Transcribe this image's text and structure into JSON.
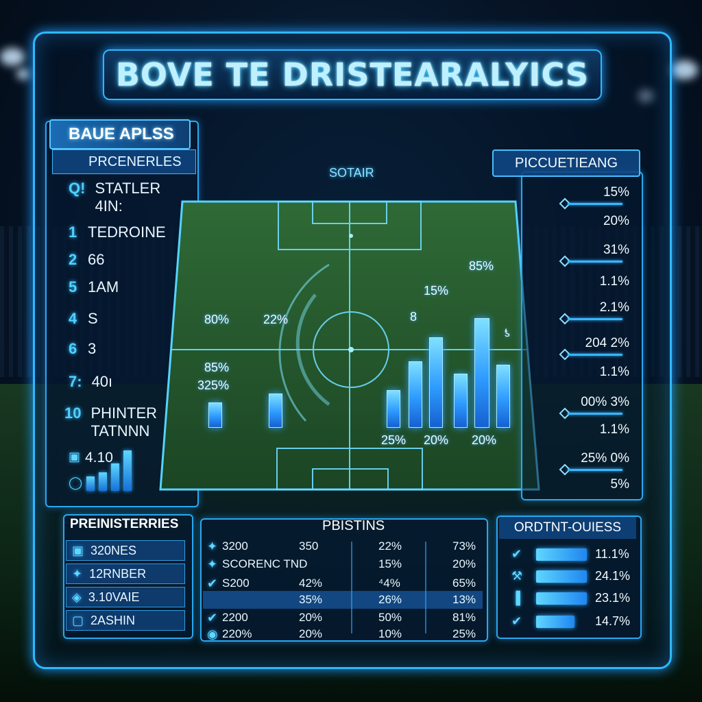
{
  "title": "BOVE TE DRISTEARALYICS",
  "left_panel": {
    "tag": "BAUE APLSS",
    "subheader": "PRCENERLES",
    "rows": [
      {
        "num": "Q!",
        "label": "STATLER",
        "label2": "4IN:"
      },
      {
        "num": "1",
        "label": "TEDROINE"
      },
      {
        "num": "2",
        "label": "66"
      },
      {
        "num": "5",
        "label": "1AM"
      },
      {
        "num": "4",
        "label": "S"
      },
      {
        "num": "6",
        "label": "3"
      },
      {
        "num": "7:",
        "label": "40ı"
      },
      {
        "num": "10",
        "label": "PHINTER",
        "label2": "TATNNN"
      }
    ],
    "mini_value": "4.10",
    "mini_bars": [
      0.28,
      0.36,
      0.52,
      0.78
    ]
  },
  "pitch": {
    "label": "SOTAIR",
    "labels": {
      "l1": "80%",
      "l2": "85%",
      "l3": "325%",
      "l4": "22%",
      "b1": "8",
      "b2": "15%",
      "b3": "85%",
      "b4": "25%",
      "b5": "20%",
      "b6": "20%",
      "b7": "ƾ"
    },
    "bars": [
      0.16,
      0.22,
      0.24,
      0.43,
      0.59,
      0.35,
      0.72,
      0.41
    ]
  },
  "right_panel": {
    "tag": "PICCUETIEANG",
    "values": [
      "15%",
      "20%",
      "31%",
      "1.1%",
      "2.1%",
      "204 2%",
      "1.1%",
      "00% 3%",
      "1.1%",
      "25% 0%",
      "5%"
    ]
  },
  "bottom_left": {
    "title": "PREINISTERRIES",
    "items": [
      {
        "icon": "shield-icon",
        "label": "320NES"
      },
      {
        "icon": "runner-icon",
        "label": "12RNBER"
      },
      {
        "icon": "badge-icon",
        "label": "3.10VAIE"
      },
      {
        "icon": "box-icon",
        "label": "2ASHIN"
      }
    ]
  },
  "bottom_mid": {
    "title": "PBISTINS",
    "rows": [
      {
        "c1": "3200",
        "c2": "350",
        "c3": "22%",
        "c4": "73%"
      },
      {
        "c1": "SCORENC TND",
        "c2": "",
        "c3": "15%",
        "c4": "20%"
      },
      {
        "c1": "S200",
        "c2": "42%",
        "c3": "⁴4%",
        "c4": "65%"
      },
      {
        "c1": "",
        "c2": "35%",
        "c3": "26%",
        "c4": "13%"
      },
      {
        "c1": "2200",
        "c2": "20%",
        "c3": "50%",
        "c4": "81%"
      },
      {
        "c1": "220%",
        "c2": "20%",
        "c3": "10%",
        "c4": "25%"
      }
    ]
  },
  "bottom_right": {
    "title": "ORDTNT-OUIESS",
    "rows": [
      {
        "icon": "check-icon",
        "value": "11.1%",
        "fill": 0.95
      },
      {
        "icon": "crossed-tools-icon",
        "value": "24.1%",
        "fill": 0.95
      },
      {
        "icon": "bars-icon",
        "value": "23.1%",
        "fill": 0.95
      },
      {
        "icon": "check-icon",
        "value": "14.7%",
        "fill": 0.72
      }
    ]
  },
  "colors": {
    "accent": "#2fb8ff",
    "bar": "#2e9bff",
    "pitch": "#1e4a28"
  }
}
